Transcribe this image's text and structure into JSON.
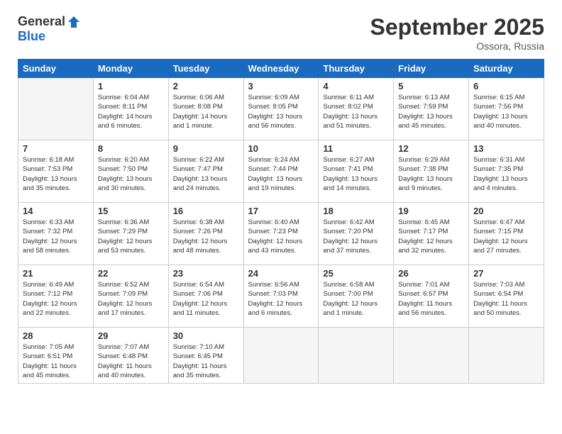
{
  "header": {
    "logo_general": "General",
    "logo_blue": "Blue",
    "month_title": "September 2025",
    "location": "Ossora, Russia"
  },
  "days_of_week": [
    "Sunday",
    "Monday",
    "Tuesday",
    "Wednesday",
    "Thursday",
    "Friday",
    "Saturday"
  ],
  "weeks": [
    [
      {
        "day": "",
        "info": ""
      },
      {
        "day": "1",
        "info": "Sunrise: 6:04 AM\nSunset: 8:11 PM\nDaylight: 14 hours\nand 6 minutes."
      },
      {
        "day": "2",
        "info": "Sunrise: 6:06 AM\nSunset: 8:08 PM\nDaylight: 14 hours\nand 1 minute."
      },
      {
        "day": "3",
        "info": "Sunrise: 6:09 AM\nSunset: 8:05 PM\nDaylight: 13 hours\nand 56 minutes."
      },
      {
        "day": "4",
        "info": "Sunrise: 6:11 AM\nSunset: 8:02 PM\nDaylight: 13 hours\nand 51 minutes."
      },
      {
        "day": "5",
        "info": "Sunrise: 6:13 AM\nSunset: 7:59 PM\nDaylight: 13 hours\nand 45 minutes."
      },
      {
        "day": "6",
        "info": "Sunrise: 6:15 AM\nSunset: 7:56 PM\nDaylight: 13 hours\nand 40 minutes."
      }
    ],
    [
      {
        "day": "7",
        "info": "Sunrise: 6:18 AM\nSunset: 7:53 PM\nDaylight: 13 hours\nand 35 minutes."
      },
      {
        "day": "8",
        "info": "Sunrise: 6:20 AM\nSunset: 7:50 PM\nDaylight: 13 hours\nand 30 minutes."
      },
      {
        "day": "9",
        "info": "Sunrise: 6:22 AM\nSunset: 7:47 PM\nDaylight: 13 hours\nand 24 minutes."
      },
      {
        "day": "10",
        "info": "Sunrise: 6:24 AM\nSunset: 7:44 PM\nDaylight: 13 hours\nand 19 minutes."
      },
      {
        "day": "11",
        "info": "Sunrise: 6:27 AM\nSunset: 7:41 PM\nDaylight: 13 hours\nand 14 minutes."
      },
      {
        "day": "12",
        "info": "Sunrise: 6:29 AM\nSunset: 7:38 PM\nDaylight: 13 hours\nand 9 minutes."
      },
      {
        "day": "13",
        "info": "Sunrise: 6:31 AM\nSunset: 7:35 PM\nDaylight: 13 hours\nand 4 minutes."
      }
    ],
    [
      {
        "day": "14",
        "info": "Sunrise: 6:33 AM\nSunset: 7:32 PM\nDaylight: 12 hours\nand 58 minutes."
      },
      {
        "day": "15",
        "info": "Sunrise: 6:36 AM\nSunset: 7:29 PM\nDaylight: 12 hours\nand 53 minutes."
      },
      {
        "day": "16",
        "info": "Sunrise: 6:38 AM\nSunset: 7:26 PM\nDaylight: 12 hours\nand 48 minutes."
      },
      {
        "day": "17",
        "info": "Sunrise: 6:40 AM\nSunset: 7:23 PM\nDaylight: 12 hours\nand 43 minutes."
      },
      {
        "day": "18",
        "info": "Sunrise: 6:42 AM\nSunset: 7:20 PM\nDaylight: 12 hours\nand 37 minutes."
      },
      {
        "day": "19",
        "info": "Sunrise: 6:45 AM\nSunset: 7:17 PM\nDaylight: 12 hours\nand 32 minutes."
      },
      {
        "day": "20",
        "info": "Sunrise: 6:47 AM\nSunset: 7:15 PM\nDaylight: 12 hours\nand 27 minutes."
      }
    ],
    [
      {
        "day": "21",
        "info": "Sunrise: 6:49 AM\nSunset: 7:12 PM\nDaylight: 12 hours\nand 22 minutes."
      },
      {
        "day": "22",
        "info": "Sunrise: 6:52 AM\nSunset: 7:09 PM\nDaylight: 12 hours\nand 17 minutes."
      },
      {
        "day": "23",
        "info": "Sunrise: 6:54 AM\nSunset: 7:06 PM\nDaylight: 12 hours\nand 11 minutes."
      },
      {
        "day": "24",
        "info": "Sunrise: 6:56 AM\nSunset: 7:03 PM\nDaylight: 12 hours\nand 6 minutes."
      },
      {
        "day": "25",
        "info": "Sunrise: 6:58 AM\nSunset: 7:00 PM\nDaylight: 12 hours\nand 1 minute."
      },
      {
        "day": "26",
        "info": "Sunrise: 7:01 AM\nSunset: 6:57 PM\nDaylight: 11 hours\nand 56 minutes."
      },
      {
        "day": "27",
        "info": "Sunrise: 7:03 AM\nSunset: 6:54 PM\nDaylight: 11 hours\nand 50 minutes."
      }
    ],
    [
      {
        "day": "28",
        "info": "Sunrise: 7:05 AM\nSunset: 6:51 PM\nDaylight: 11 hours\nand 45 minutes."
      },
      {
        "day": "29",
        "info": "Sunrise: 7:07 AM\nSunset: 6:48 PM\nDaylight: 11 hours\nand 40 minutes."
      },
      {
        "day": "30",
        "info": "Sunrise: 7:10 AM\nSunset: 6:45 PM\nDaylight: 11 hours\nand 35 minutes."
      },
      {
        "day": "",
        "info": ""
      },
      {
        "day": "",
        "info": ""
      },
      {
        "day": "",
        "info": ""
      },
      {
        "day": "",
        "info": ""
      }
    ]
  ]
}
